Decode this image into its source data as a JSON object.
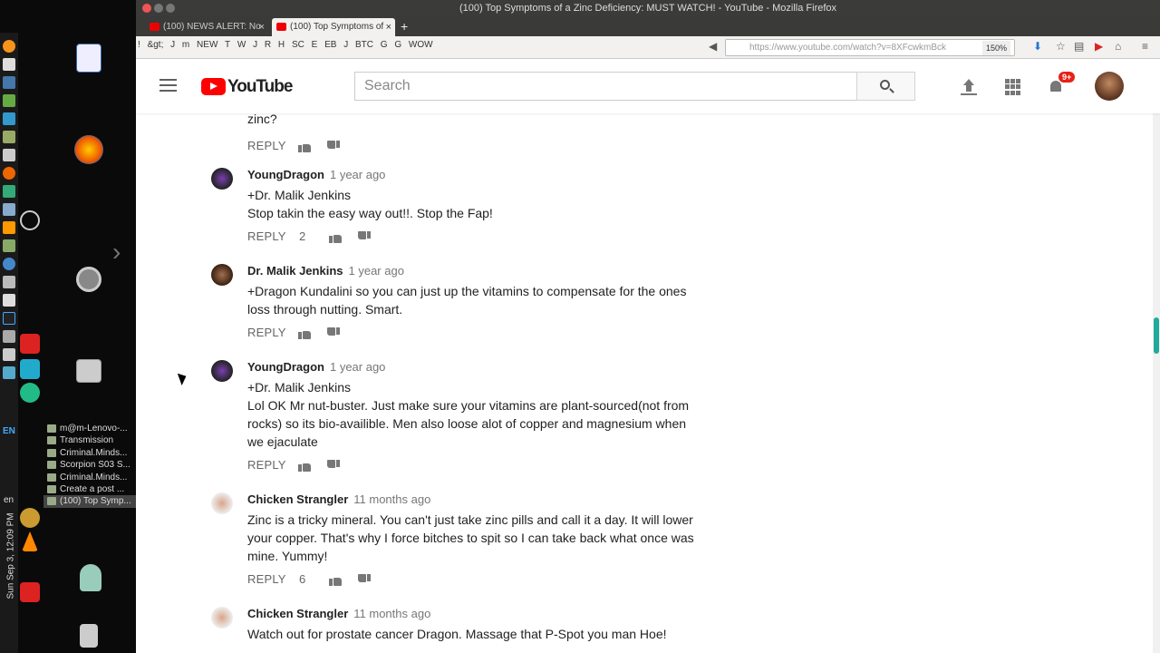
{
  "window": {
    "title": "(100) Top Symptoms of a Zinc Deficiency: MUST WATCH! - YouTube - Mozilla Firefox"
  },
  "tabs": [
    {
      "label": "(100) NEWS ALERT: No"
    },
    {
      "label": "(100) Top Symptoms of"
    }
  ],
  "bookmarks": [
    "!",
    "",
    "&gt;",
    "J",
    "m",
    "NEW",
    "T",
    "W",
    "J",
    "R",
    "H",
    "SC",
    "E",
    "EB",
    "J",
    "BTC",
    "G",
    "G",
    "WOW"
  ],
  "url": {
    "value": "https://www.youtube.com/watch?v=8XFcwkmBck",
    "zoom": "150%"
  },
  "youtube": {
    "logo": "YouTube",
    "search_placeholder": "Search",
    "notifications": "9+"
  },
  "taskbar": [
    "m@m-Lenovo-...",
    "Transmission",
    "Criminal.Minds...",
    "Scorpion S03 S...",
    "Criminal.Minds...",
    "Create a post ...",
    "(100) Top Symp..."
  ],
  "tray": {
    "lang": "EN",
    "lang2": "en",
    "clock": "Sun Sep 3, 12:09 PM"
  },
  "prev_comment": {
    "text": "zinc?",
    "reply": "REPLY"
  },
  "comments": [
    {
      "author": "YoungDragon",
      "time": "1 year ago",
      "text": "+Dr. Malik Jenkins\nStop takin the easy way out!!. Stop the Fap!",
      "reply": "REPLY",
      "likes": "2"
    },
    {
      "author": "Dr. Malik Jenkins",
      "time": "1 year ago",
      "text": "+Dragon Kundalini so you can just up the vitamins to compensate for the ones\nloss through nutting. Smart.",
      "reply": "REPLY",
      "likes": ""
    },
    {
      "author": "YoungDragon",
      "time": "1 year ago",
      "text": "+Dr. Malik Jenkins\nLol OK Mr nut-buster. Just make sure your vitamins are plant-sourced(not from\nrocks) so its bio-availible. Men also loose alot of copper and magnesium when\nwe ejaculate",
      "reply": "REPLY",
      "likes": ""
    },
    {
      "author": "Chicken Strangler",
      "time": "11 months ago",
      "text": "Zinc is a tricky mineral. You can't just take zinc pills and call it a day. It will lower\nyour copper. That's why I force bitches to spit so I can take back what once was\nmine. Yummy!",
      "reply": "REPLY",
      "likes": "6"
    },
    {
      "author": "Chicken Strangler",
      "time": "11 months ago",
      "text": "Watch out for prostate cancer Dragon. Massage that P-Spot you man Hoe!",
      "reply": "REPLY",
      "likes": ""
    }
  ]
}
